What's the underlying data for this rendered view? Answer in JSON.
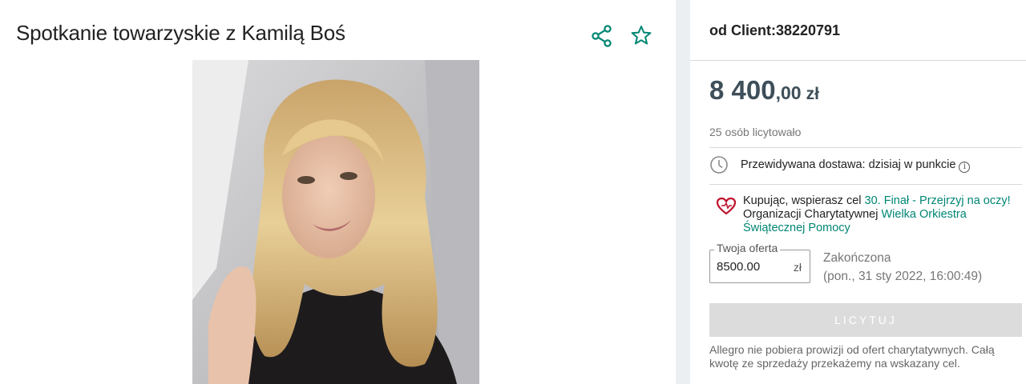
{
  "listing": {
    "title": "Spotkanie towarzyskie z Kamilą Boś"
  },
  "icons": {
    "share": "share-icon",
    "favorite": "star-icon",
    "clock": "clock-icon",
    "info": "info-icon",
    "heart": "heart-icon",
    "accent_color": "#008673"
  },
  "seller": {
    "label": "od Client:38220791"
  },
  "price": {
    "main": "8 400",
    "cents": ",00",
    "currency": "zł",
    "color": "#3e4f5a"
  },
  "bidders_text": "25 osób licytowało",
  "delivery": {
    "text": "Przewidywana dostawa: dzisiaj w punkcie",
    "info_glyph": "i"
  },
  "charity": {
    "prefix": "Kupując, wspierasz cel",
    "goal_link": "30. Finał - Przejrzyj na oczy!",
    "org_prefix": "Organizacji Charytatywnej",
    "org_link": "Wielka Orkiestra Świątecznej Pomocy"
  },
  "offer": {
    "label": "Twoja oferta",
    "value": "8500.00",
    "currency": "zł"
  },
  "auction_status": {
    "status": "Zakończona",
    "date": "(pon., 31 sty 2022, 16:00:49)"
  },
  "bid_button_label": "LICYTUJ",
  "footer_note": "Allegro nie pobiera prowizji od ofert charytatywnych. Całą kwotę ze sprzedaży przekażemy na wskazany cel."
}
